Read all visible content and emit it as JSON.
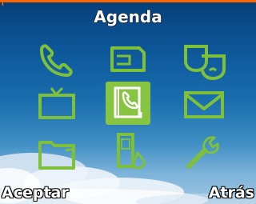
{
  "header": {
    "title": "Agenda"
  },
  "softkeys": {
    "left": "Aceptar",
    "right": "Atrás"
  },
  "colors": {
    "icon": "#7fc03a",
    "selected_bg": "#86c441",
    "accent": "#ff6600"
  },
  "menu": {
    "selected_index": 4,
    "items": [
      {
        "icon": "phone-icon"
      },
      {
        "icon": "sim-card-icon"
      },
      {
        "icon": "theme-masks-icon"
      },
      {
        "icon": "tv-icon"
      },
      {
        "icon": "phonebook-icon"
      },
      {
        "icon": "envelope-icon"
      },
      {
        "icon": "folder-icon"
      },
      {
        "icon": "phone-settings-icon"
      },
      {
        "icon": "wrench-icon"
      }
    ]
  }
}
